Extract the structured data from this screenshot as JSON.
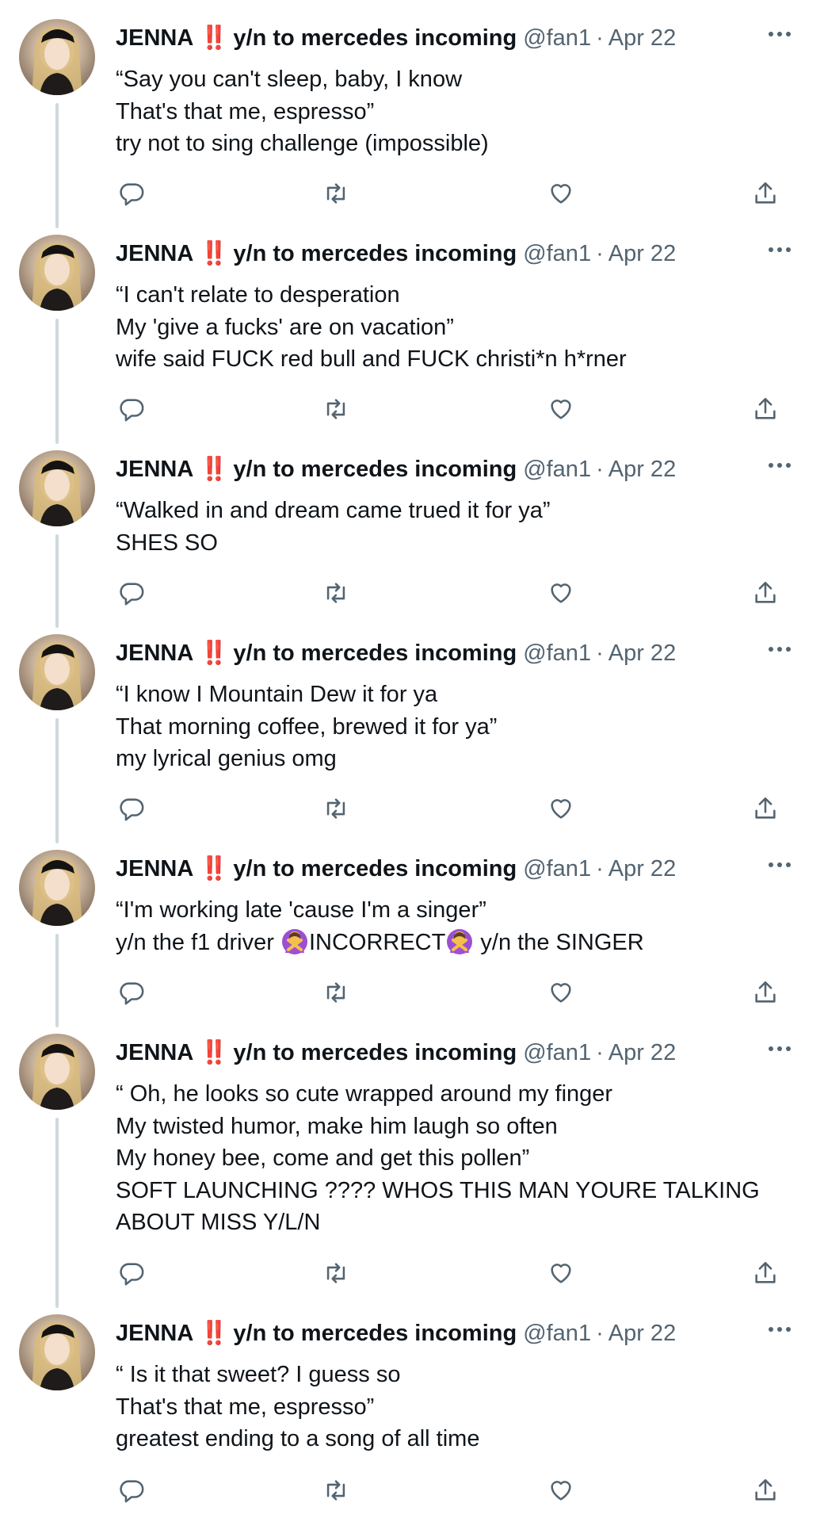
{
  "author": {
    "name": "JENNA",
    "bang": "‼️",
    "title": "y/n to mercedes incoming",
    "handle": "@fan1",
    "separator": "·",
    "date": "Apr 22"
  },
  "icons": {
    "reply": "reply-icon",
    "retweet": "retweet-icon",
    "like": "heart-icon",
    "share": "share-icon",
    "more": "more-icon",
    "emoji": "person-gesturing-no-emoji"
  },
  "colors": {
    "text": "#0f1419",
    "muted": "#536471",
    "bang": "#e0242e",
    "thread_line": "#cfd9de"
  },
  "tweets": [
    {
      "lines": [
        "“Say you can't sleep, baby, I know",
        "That's that me, espresso”",
        "try not to sing challenge (impossible)"
      ]
    },
    {
      "lines": [
        "“I can't relate to desperation",
        "My 'give a fucks' are on vacation”",
        "wife said FUCK red bull and FUCK christi*n h*rner"
      ]
    },
    {
      "lines": [
        "“Walked in and dream came trued it for ya”",
        "SHES SO"
      ]
    },
    {
      "lines": [
        "“I know I Mountain Dew it for ya",
        "That morning coffee, brewed it for ya”",
        "my lyrical genius omg"
      ]
    },
    {
      "lines": [
        "“I'm working late 'cause I'm a singer”"
      ],
      "emoji_line": {
        "part1": "y/n the f1 driver ",
        "part2": "INCORRECT",
        "part3": " y/n the SINGER"
      }
    },
    {
      "lines": [
        "“ Oh, he looks so cute wrapped around my finger",
        "My twisted humor, make him laugh so often",
        "My honey bee, come and get this pollen”",
        "SOFT LAUNCHING ???? WHOS THIS MAN YOURE TALKING",
        "ABOUT MISS Y/L/N"
      ]
    },
    {
      "lines": [
        "“ Is it that sweet? I guess so",
        "That's that me, espresso”",
        "greatest ending to a song of all time"
      ]
    }
  ]
}
